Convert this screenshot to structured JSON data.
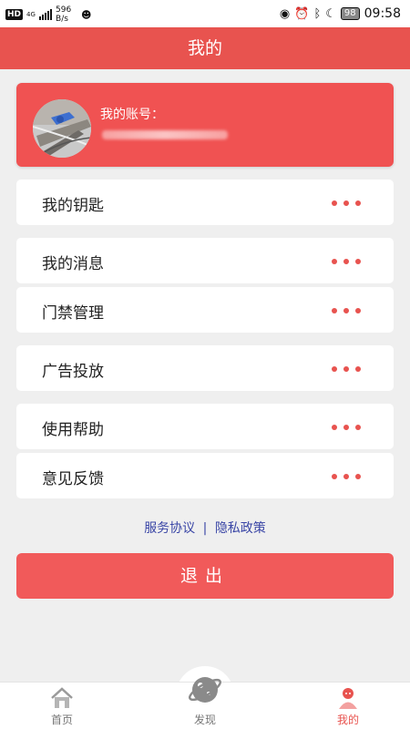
{
  "status_bar": {
    "hd": "HD",
    "network": "4G",
    "speed_value": "596",
    "speed_unit": "B/s",
    "battery": "98",
    "time": "09:58"
  },
  "header": {
    "title": "我的"
  },
  "profile": {
    "account_label": "我的账号："
  },
  "menu": [
    {
      "label": "我的钥匙"
    },
    {
      "label": "我的消息"
    },
    {
      "label": "门禁管理"
    },
    {
      "label": "广告投放"
    },
    {
      "label": "使用帮助"
    },
    {
      "label": "意见反馈"
    }
  ],
  "links": {
    "service_agreement": "服务协议",
    "separator": "|",
    "privacy_policy": "隐私政策"
  },
  "logout_label": "退出",
  "bottom_nav": {
    "home": "首页",
    "discover": "发现",
    "mine": "我的"
  },
  "colors": {
    "accent": "#e8534f",
    "link": "#3a46a6"
  },
  "icons": {
    "status": [
      "signal-icon",
      "eye-icon",
      "alarm-icon",
      "bluetooth-icon",
      "moon-icon",
      "battery-icon"
    ],
    "nav": [
      "home-icon",
      "planet-icon",
      "user-icon"
    ]
  }
}
